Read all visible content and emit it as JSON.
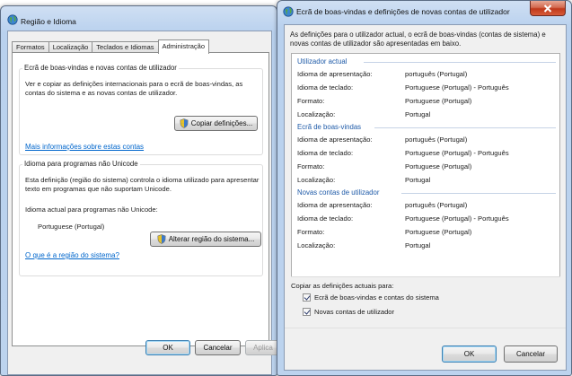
{
  "left_window": {
    "title": "Região e Idioma",
    "tabs": [
      "Formatos",
      "Localização",
      "Teclados e Idiomas",
      "Administração"
    ],
    "welcome_group": {
      "heading": "Ecrã de boas-vindas e novas contas de utilizador",
      "description": "Ver e copiar as definições internacionais para o ecrã de boas-vindas, as contas do sistema e as novas contas de utilizador.",
      "copy_button": "Copiar definições...",
      "more_info_link": "Mais informações sobre estas contas"
    },
    "unicode_group": {
      "heading": "Idioma para programas não Unicode",
      "description": "Esta definição (região do sistema) controla o idioma utilizado para apresentar texto em programas que não suportam Unicode.",
      "current_label": "Idioma actual para programas não Unicode:",
      "current_value": "Portuguese (Portugal)",
      "change_button": "Alterar região do sistema...",
      "link": "O que é a região do sistema?"
    },
    "buttons": {
      "ok": "OK",
      "cancel": "Cancelar",
      "apply": "Aplica"
    }
  },
  "right_window": {
    "title": "Ecrã de boas-vindas e definições de novas contas de utilizador",
    "intro": "As definições para o utilizador actual, o ecrã de boas-vindas (contas de sistema) e novas contas de utilizador são apresentadas em baixo.",
    "labels": {
      "display_language": "Idioma de apresentação:",
      "input_language": "Idioma de teclado:",
      "format": "Formato:",
      "location": "Localização:"
    },
    "sections": [
      {
        "title": "Utilizador actual",
        "display": "português (Portugal)",
        "input": "Portuguese (Portugal) - Português",
        "format": "Portuguese (Portugal)",
        "location": "Portugal"
      },
      {
        "title": "Ecrã de boas-vindas",
        "display": "português (Portugal)",
        "input": "Portuguese (Portugal) - Português",
        "format": "Portuguese (Portugal)",
        "location": "Portugal"
      },
      {
        "title": "Novas contas de utilizador",
        "display": "português (Portugal)",
        "input": "Portuguese (Portugal) - Português",
        "format": "Portuguese (Portugal)",
        "location": "Portugal"
      }
    ],
    "copy_label": "Copiar as definições actuais para:",
    "checkbox_welcome": "Ecrã de boas-vindas e contas do sistema",
    "checkbox_new_users": "Novas contas de utilizador",
    "buttons": {
      "ok": "OK",
      "cancel": "Cancelar"
    }
  },
  "colors": {
    "section_header": "#1e5aa8",
    "link": "#0066cc",
    "close_button": "#c0391b"
  }
}
